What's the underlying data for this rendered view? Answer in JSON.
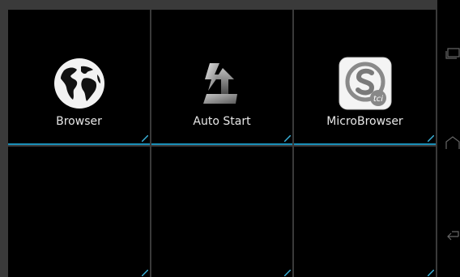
{
  "accent_color": "#1a8fb8",
  "apps": [
    {
      "label": "Browser",
      "icon": "globe-icon"
    },
    {
      "label": "Auto Start",
      "icon": "autostart-arrow-icon"
    },
    {
      "label": "MicroBrowser",
      "icon": "microbrowser-s-icon"
    }
  ],
  "microbrowser_icon_text": "tci",
  "nav": {
    "recent": "recent-apps-icon",
    "home": "home-icon",
    "back": "back-icon"
  }
}
